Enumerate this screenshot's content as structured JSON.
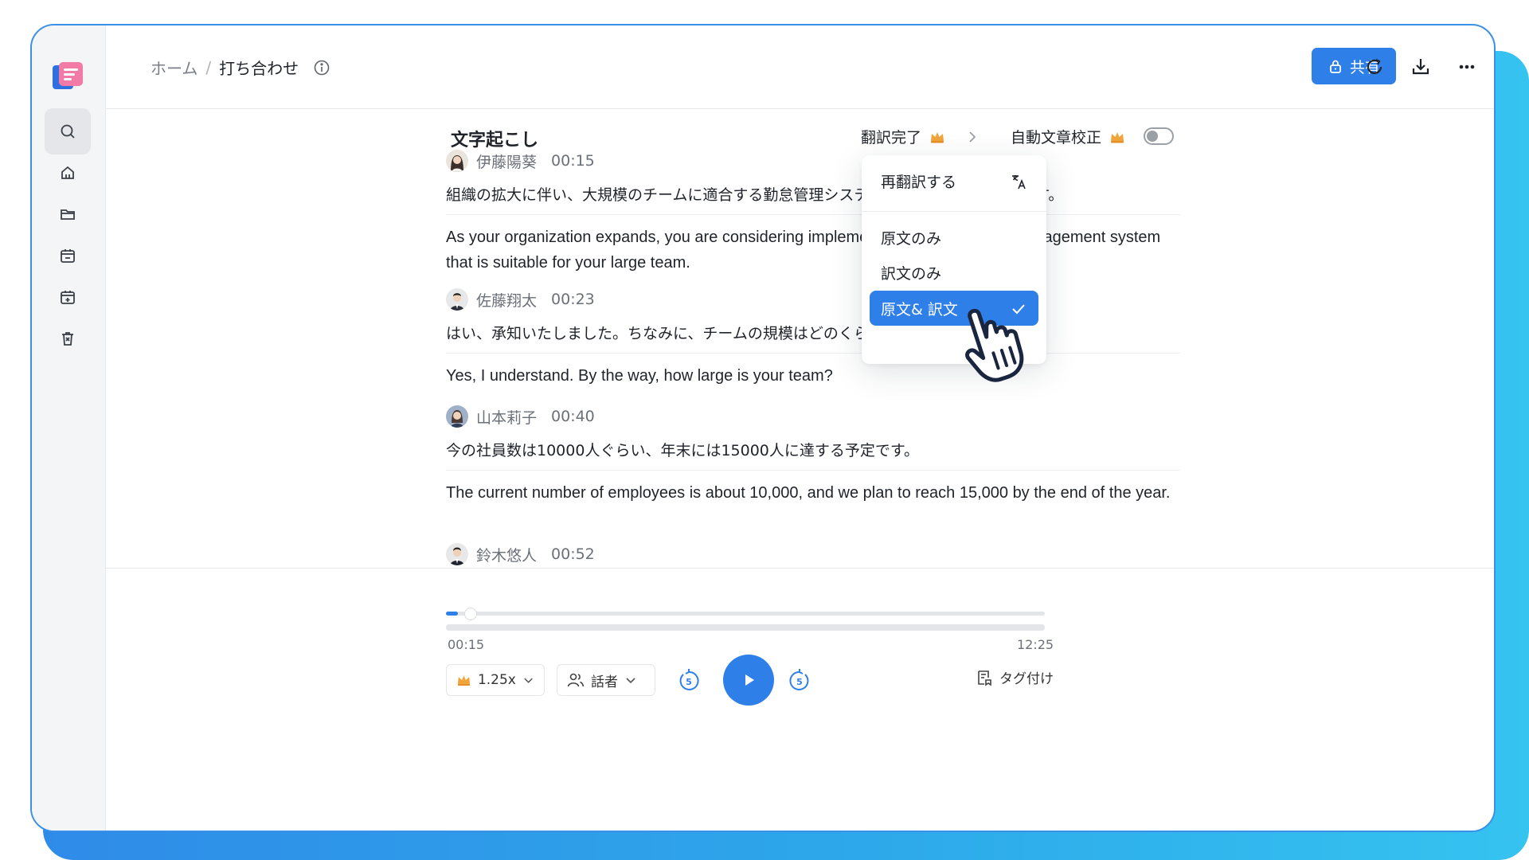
{
  "header": {
    "breadcrumb_home": "ホーム",
    "breadcrumb_sep": "/",
    "breadcrumb_current": "打ち合わせ",
    "share_label": "共有"
  },
  "sidebar": {
    "items": [
      {
        "icon": "search-icon"
      },
      {
        "icon": "home-icon"
      },
      {
        "icon": "folder-icon"
      },
      {
        "icon": "calendar-icon"
      },
      {
        "icon": "calendar-add-icon"
      },
      {
        "icon": "trash-icon"
      }
    ]
  },
  "transcript": {
    "title": "文字起こし",
    "translation_status": "翻訳完了",
    "autocorrect_label": "自動文章校正",
    "autocorrect_on": false,
    "entries": [
      {
        "speaker": "伊藤陽葵",
        "time": "00:15",
        "original": "組織の拡大に伴い、大規模のチームに適合する勤怠管理システムの導入を検討しています。",
        "translation": "As your organization expands, you are considering implementing an attendance management system that is suitable for your large team."
      },
      {
        "speaker": "佐藤翔太",
        "time": "00:23",
        "original": "はい、承知いたしました。ちなみに、チームの規模はどのくらいでしょうか。",
        "translation": "Yes, I understand. By the way, how large is your team?"
      },
      {
        "speaker": "山本莉子",
        "time": "00:40",
        "original": "今の社員数は10000人ぐらい、年末には15000人に達する予定です。",
        "translation": "The current number of employees is about 10,000, and we plan to reach 15,000 by the end of the year."
      },
      {
        "speaker": "鈴木悠人",
        "time": "00:52",
        "original": "",
        "translation": ""
      }
    ]
  },
  "dropdown": {
    "retranslate": "再翻訳する",
    "options": [
      "原文のみ",
      "訳文のみ",
      "原文& 訳文"
    ],
    "selected_index": 2
  },
  "player": {
    "current_time": "00:15",
    "total_time": "12:25",
    "progress_fraction": 0.02,
    "speed_label": "1.25x",
    "speaker_label": "話者",
    "skip_seconds": "5",
    "tag_label": "タグ付け"
  },
  "colors": {
    "accent": "#2f7fe9",
    "background_band": "#2da8ea",
    "crown": "#f0a43a"
  }
}
